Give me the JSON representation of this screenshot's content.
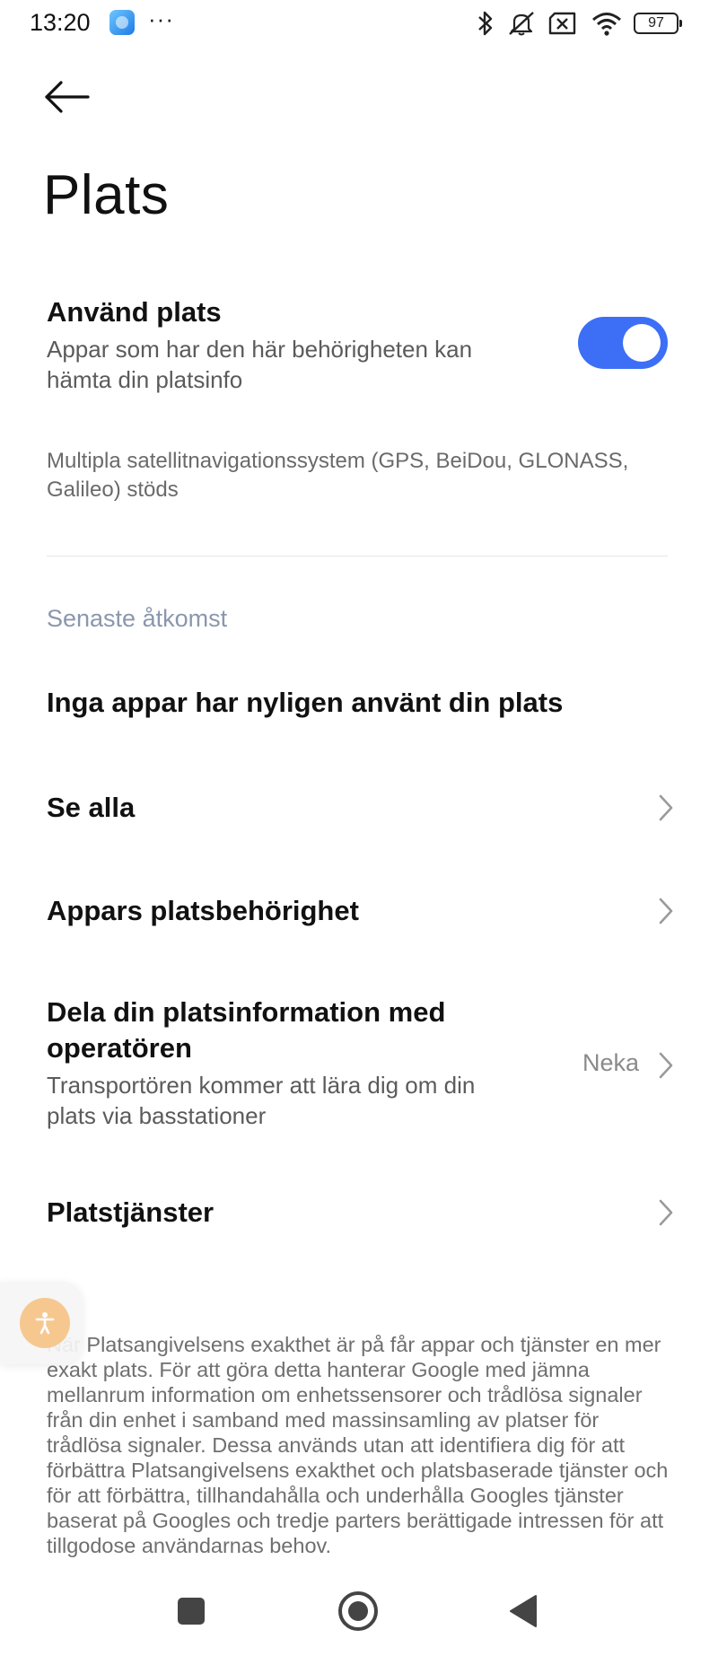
{
  "status_bar": {
    "time": "13:20",
    "dots": "···",
    "battery_level": "97"
  },
  "header": {
    "title": "Plats"
  },
  "use_location": {
    "title": "Använd plats",
    "subtitle": "Appar som har den här behörigheten kan hämta din platsinfo",
    "enabled": true,
    "accent_color": "#3c6ff5"
  },
  "gnss_info": "Multipla satellitnavigationssystem (GPS, BeiDou, GLONASS, Galileo) stöds",
  "recent_access": {
    "header": "Senaste åtkomst",
    "empty_text": "Inga appar har nyligen använt din plats"
  },
  "items": [
    {
      "title": "Se alla"
    },
    {
      "title": "Appars platsbehörighet"
    },
    {
      "title": "Dela din platsinformation med operatören",
      "subtitle": "Transportören kommer att lära dig om din plats via basstationer",
      "value": "Neka"
    },
    {
      "title": "Platstjänster"
    }
  ],
  "footer_text": "När Platsangivelsens exakthet är på får appar och tjänster en mer exakt plats. För att göra detta hanterar Google med jämna mellanrum information om enhetssensorer och trådlösa signaler från din enhet i samband med massinsamling av platser för trådlösa signaler. Dessa används utan att identifiera dig för att förbättra Platsangivelsens exakthet och platsbaserade tjänster och för att förbättra, tillhandahålla och underhålla Googles tjänster baserat på Googles och tredje parters berättigade intressen för att tillgodose användarnas behov."
}
